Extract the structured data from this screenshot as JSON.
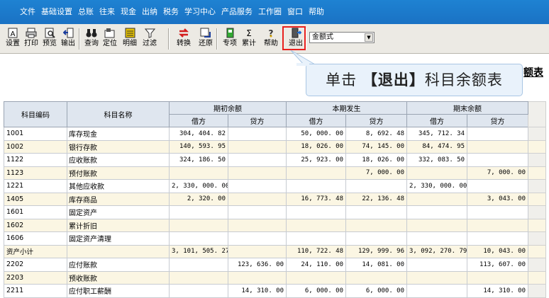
{
  "menu": [
    "文件",
    "基础设置",
    "总账",
    "往来",
    "现金",
    "出纳",
    "税务",
    "学习中心",
    "产品服务",
    "工作圈",
    "窗口",
    "帮助"
  ],
  "toolbar": {
    "buttons": [
      {
        "label": "设置",
        "icon": "settings-icon"
      },
      {
        "label": "打印",
        "icon": "print-icon"
      },
      {
        "label": "预览",
        "icon": "preview-icon"
      },
      {
        "label": "输出",
        "icon": "export-icon"
      },
      {
        "label": "查询",
        "icon": "binoculars-icon"
      },
      {
        "label": "定位",
        "icon": "locate-icon"
      },
      {
        "label": "明细",
        "icon": "detail-icon"
      },
      {
        "label": "过滤",
        "icon": "filter-icon"
      },
      {
        "label": "转换",
        "icon": "convert-icon"
      },
      {
        "label": "还原",
        "icon": "restore-icon"
      },
      {
        "label": "专项",
        "icon": "special-icon"
      },
      {
        "label": "累计",
        "icon": "sigma-icon"
      },
      {
        "label": "帮助",
        "icon": "help-icon"
      },
      {
        "label": "退出",
        "icon": "exit-icon"
      }
    ],
    "format_select": "金额式"
  },
  "report_title_partial": "额表",
  "callout": {
    "prefix": "单击 ",
    "bracket_open": "【",
    "action": "退出",
    "bracket_close": "】",
    "suffix": "科目余额表"
  },
  "table": {
    "headers": {
      "code": "科目编码",
      "name": "科目名称",
      "groups": [
        "期初余额",
        "本期发生",
        "期末余额"
      ],
      "debit": "借方",
      "credit": "贷方"
    },
    "rows": [
      {
        "code": "1001",
        "name": "库存现金",
        "v": [
          "304, 404. 82",
          "",
          "50, 000. 00",
          "8, 692. 48",
          "345, 712. 34",
          ""
        ]
      },
      {
        "code": "1002",
        "name": "银行存款",
        "v": [
          "140, 593. 95",
          "",
          "18, 026. 00",
          "74, 145. 00",
          "84, 474. 95",
          ""
        ]
      },
      {
        "code": "1122",
        "name": "应收账款",
        "v": [
          "324, 186. 50",
          "",
          "25, 923. 00",
          "18, 026. 00",
          "332, 083. 50",
          ""
        ]
      },
      {
        "code": "1123",
        "name": "预付账款",
        "v": [
          "",
          "",
          "",
          "7, 000. 00",
          "",
          "7, 000. 00"
        ]
      },
      {
        "code": "1221",
        "name": "其他应收款",
        "v": [
          "2, 330, 000. 00",
          "",
          "",
          "",
          "2, 330, 000. 00",
          ""
        ]
      },
      {
        "code": "1405",
        "name": "库存商品",
        "v": [
          "2, 320. 00",
          "",
          "16, 773. 48",
          "22, 136. 48",
          "",
          "3, 043. 00"
        ]
      },
      {
        "code": "1601",
        "name": "固定资产",
        "v": [
          "",
          "",
          "",
          "",
          "",
          ""
        ]
      },
      {
        "code": "1602",
        "name": "累计折旧",
        "v": [
          "",
          "",
          "",
          "",
          "",
          ""
        ]
      },
      {
        "code": "1606",
        "name": "固定资产清理",
        "v": [
          "",
          "",
          "",
          "",
          "",
          ""
        ]
      },
      {
        "code": "资产小计",
        "name": "",
        "v": [
          "3, 101, 505. 27",
          "",
          "110, 722. 48",
          "129, 999. 96",
          "3, 092, 270. 79",
          "10, 043. 00"
        ]
      },
      {
        "code": "2202",
        "name": "应付账款",
        "v": [
          "",
          "123, 636. 00",
          "24, 110. 00",
          "14, 081. 00",
          "",
          "113, 607. 00"
        ]
      },
      {
        "code": "2203",
        "name": "预收账款",
        "v": [
          "",
          "",
          "",
          "",
          "",
          ""
        ]
      },
      {
        "code": "2211",
        "name": "应付职工薪酬",
        "v": [
          "",
          "14, 310. 00",
          "6, 000. 00",
          "6, 000. 00",
          "",
          "14, 310. 00"
        ]
      }
    ]
  }
}
